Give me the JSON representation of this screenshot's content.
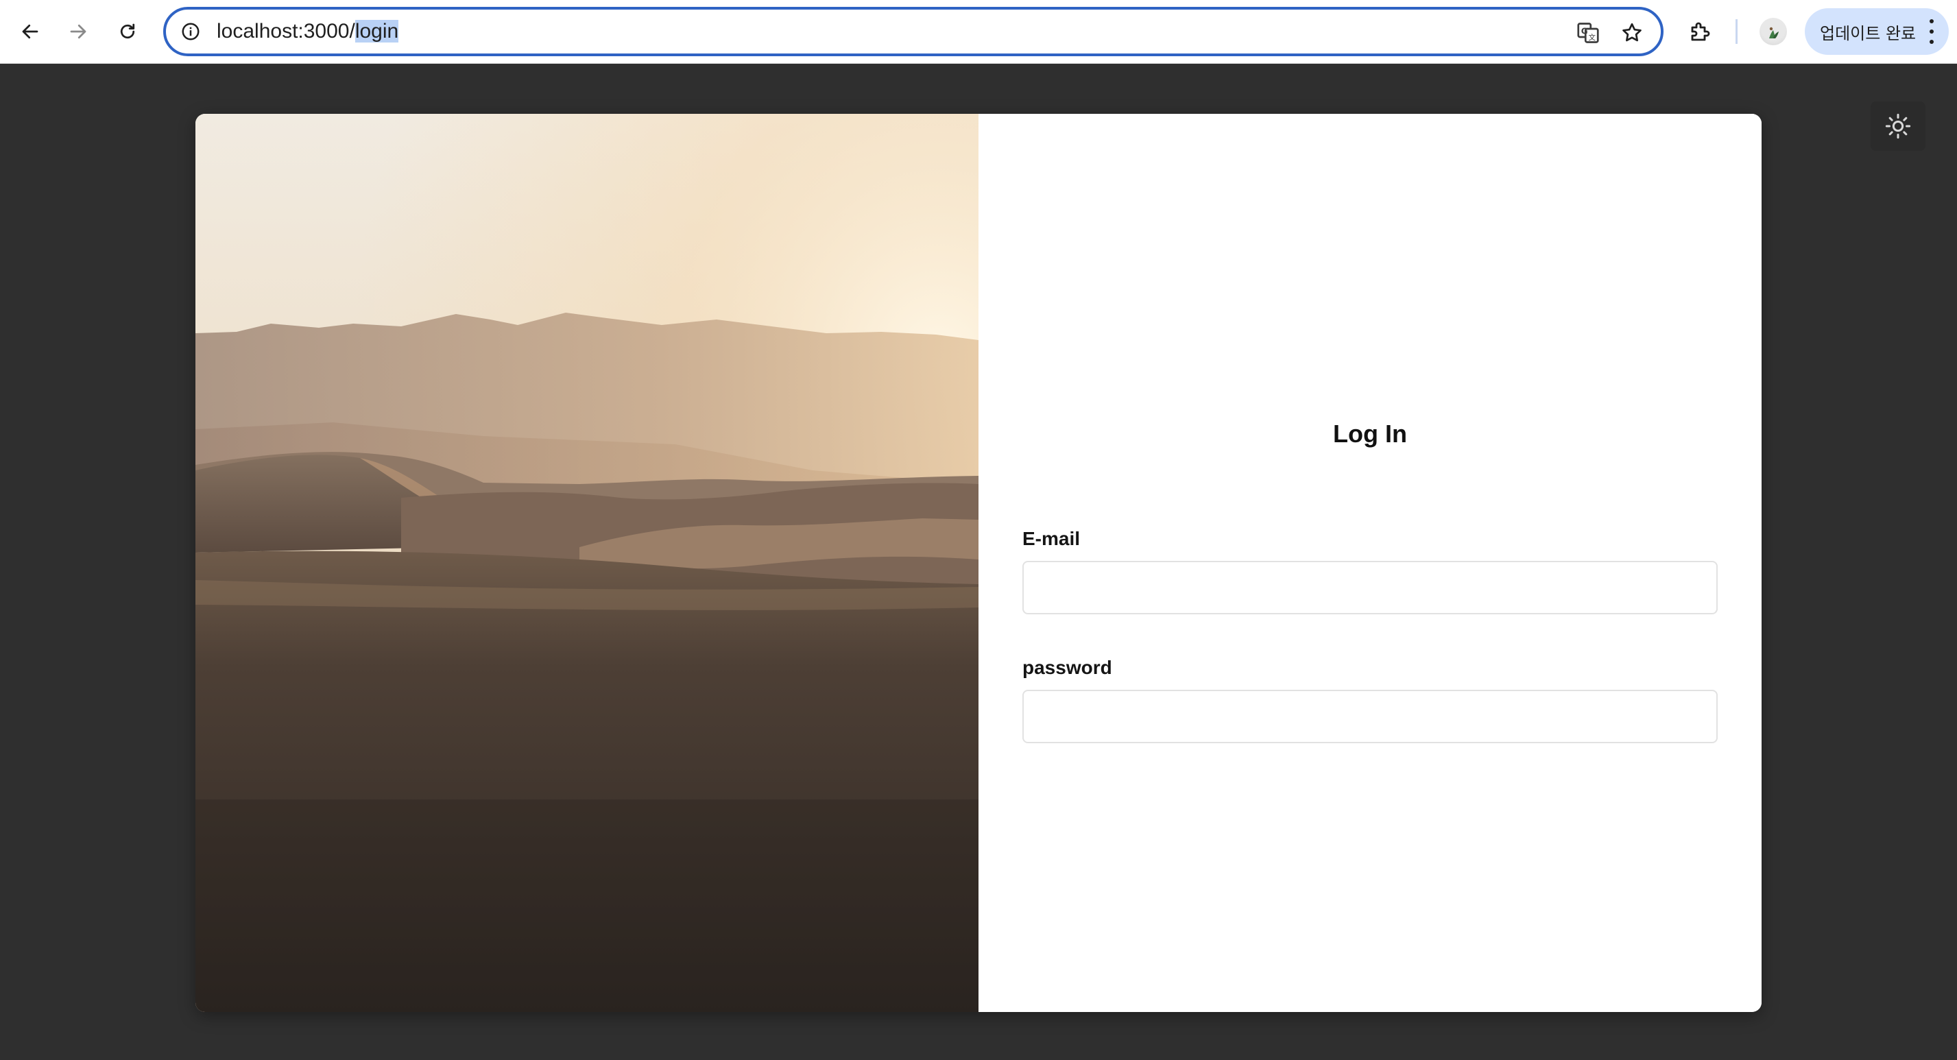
{
  "browser": {
    "url_host": "localhost:3000/",
    "url_path": "login",
    "update_label": "업데이트 완료"
  },
  "icons": {
    "back": "arrow-left-icon",
    "forward": "arrow-right-icon",
    "reload": "reload-icon",
    "site_info": "info-icon",
    "translate": "translate-icon",
    "bookmark": "star-icon",
    "extensions": "puzzle-icon",
    "menu": "kebab-menu-icon",
    "theme": "sun-icon",
    "close": "close-icon",
    "submit": "unlock-icon"
  },
  "login": {
    "title": "Log In",
    "email_label": "E-mail",
    "email_value": "",
    "password_label": "password",
    "password_value": ""
  },
  "colors": {
    "page_background": "#2f2f2f",
    "omnibox_border": "#2f63c4",
    "update_button": "#d3e3fd",
    "submit_button": "#1c1c1c"
  }
}
